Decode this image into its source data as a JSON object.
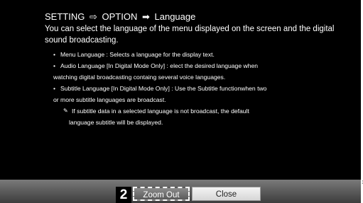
{
  "breadcrumb": {
    "part1": "SETTING",
    "arrow1": "⇨",
    "part2": "OPTION",
    "arrow2": "➡",
    "part3": "Language"
  },
  "intro": "You can select the language of the menu displayed on the screen and the digital sound broadcasting.",
  "items": [
    {
      "bullet": "•",
      "line1": "Menu Language : Selects a language for the display text.",
      "line2": ""
    },
    {
      "bullet": "•",
      "line1": "Audio Language  [In Digital Mode Only] : elect the desired language when",
      "line2": "watching digital broadcasting containg several voice languages."
    },
    {
      "bullet": "•",
      "line1": "Subtitle Language [In Digital Mode Only] : Use the Subtitle functionwhen two",
      "line2": "or more subtitle languages are broadcast."
    }
  ],
  "note": {
    "icon": "✎",
    "line1": "If subtitle data in a selected language is not broadcast, the default",
    "line2": "language subtitle will be displayed."
  },
  "buttons": {
    "step_number": "2",
    "zoom_out_label": "Zoom Out",
    "close_label": "Close"
  },
  "page_number": "1"
}
